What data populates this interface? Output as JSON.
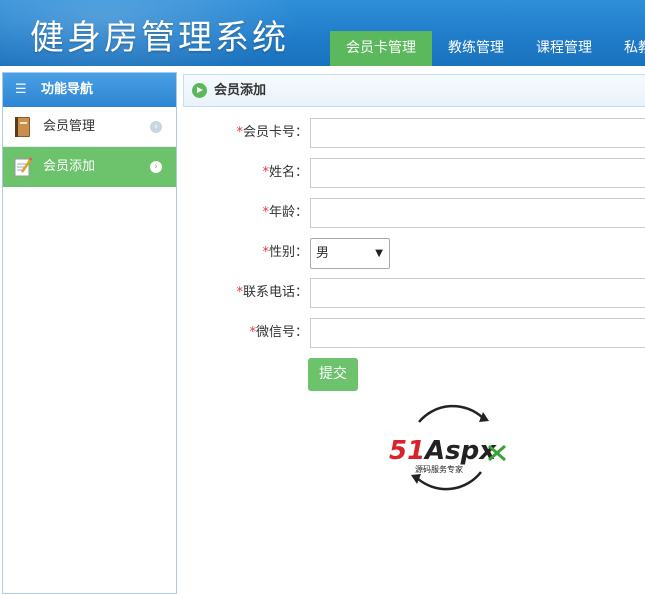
{
  "app": {
    "title": "健身房管理系统"
  },
  "topnav": {
    "tabs": [
      {
        "label": "会员卡管理",
        "active": true
      },
      {
        "label": "教练管理",
        "active": false
      },
      {
        "label": "课程管理",
        "active": false
      },
      {
        "label": "私教",
        "active": false
      }
    ]
  },
  "sidebar": {
    "header": "功能导航",
    "items": [
      {
        "label": "会员管理",
        "active": false,
        "icon": "book-icon"
      },
      {
        "label": "会员添加",
        "active": true,
        "icon": "notepad-pencil-icon"
      }
    ]
  },
  "panel": {
    "title": "会员添加"
  },
  "form": {
    "required_mark": "*",
    "fields": [
      {
        "label": "会员卡号：",
        "value": ""
      },
      {
        "label": "姓名：",
        "value": ""
      },
      {
        "label": "年龄：",
        "value": ""
      },
      {
        "label": "性别：",
        "value": "男"
      },
      {
        "label": "联系电话：",
        "value": ""
      },
      {
        "label": "微信号：",
        "value": ""
      }
    ],
    "submit_label": "提交"
  },
  "logo": {
    "brand": "51Aspx",
    "tagline": "源码服务专家"
  },
  "colors": {
    "header_blue": "#1f7bc8",
    "accent_green": "#5cb85c",
    "required_red": "#e33333"
  }
}
